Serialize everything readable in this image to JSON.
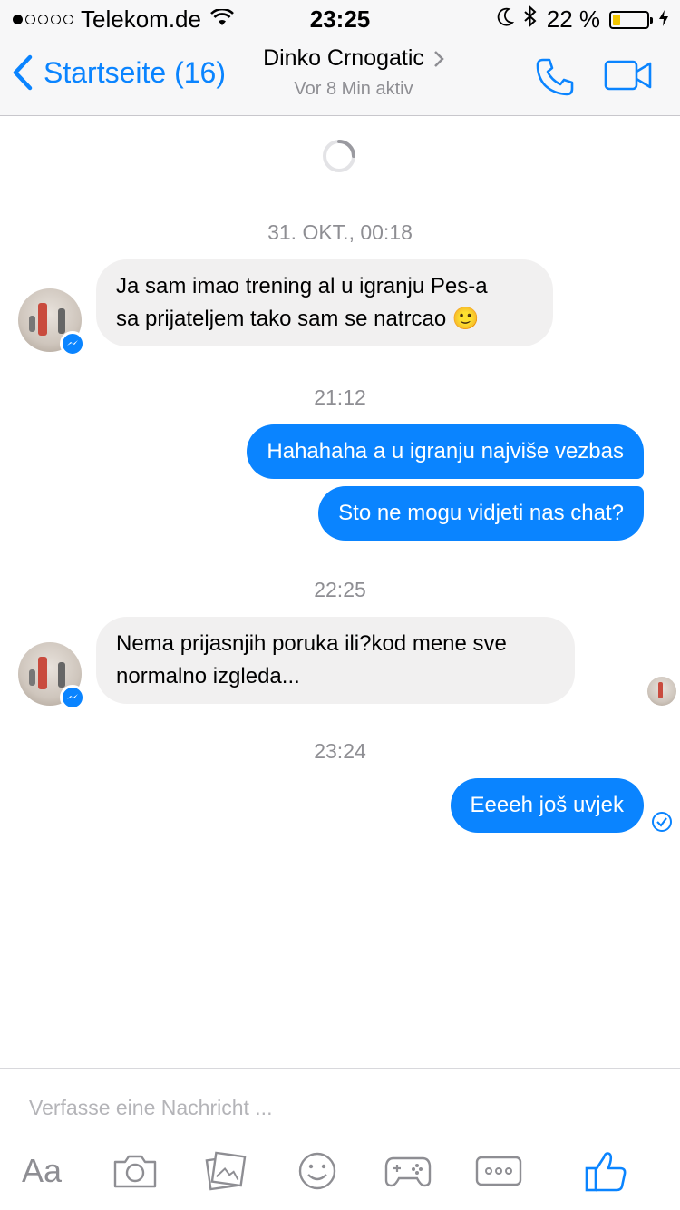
{
  "status": {
    "carrier": "Telekom.de",
    "time": "23:25",
    "battery_pct": "22 %",
    "battery_level": 0.22
  },
  "header": {
    "back_label": "Startseite (16)",
    "contact_name": "Dinko Crnogatic",
    "contact_status": "Vor 8 Min aktiv"
  },
  "messages": [
    {
      "type": "timestamp",
      "text": "31. OKT., 00:18"
    },
    {
      "type": "in",
      "lines": [
        "Ja sam imao trening al u igranju Pes-a",
        "sa prijateljem tako sam se natrcao 🙂"
      ]
    },
    {
      "type": "timestamp",
      "text": "21:12"
    },
    {
      "type": "out",
      "text": "Hahahaha a u igranju najviše vezbas"
    },
    {
      "type": "out",
      "text": "Sto ne mogu vidjeti nas chat?"
    },
    {
      "type": "timestamp",
      "text": "22:25"
    },
    {
      "type": "in",
      "lines": [
        "Nema prijasnjih poruka ili?kod mene sve",
        "normalno izgleda..."
      ]
    },
    {
      "type": "timestamp",
      "text": "23:24"
    },
    {
      "type": "out",
      "text": "Eeeeh još uvjek"
    }
  ],
  "composer": {
    "placeholder": "Verfasse eine Nachricht ...",
    "aa_label": "Aa"
  },
  "colors": {
    "accent": "#0a84ff",
    "incoming_bubble": "#f1f0f0",
    "timestamp": "#8e8e93"
  },
  "icons": [
    "wifi-icon",
    "moon-icon",
    "bluetooth-icon",
    "battery-icon",
    "back-chevron-icon",
    "chevron-right-icon",
    "phone-icon",
    "video-icon",
    "messenger-badge-icon",
    "seen-check-icon",
    "camera-icon",
    "gallery-icon",
    "smiley-icon",
    "gamepad-icon",
    "more-icon",
    "like-icon"
  ]
}
